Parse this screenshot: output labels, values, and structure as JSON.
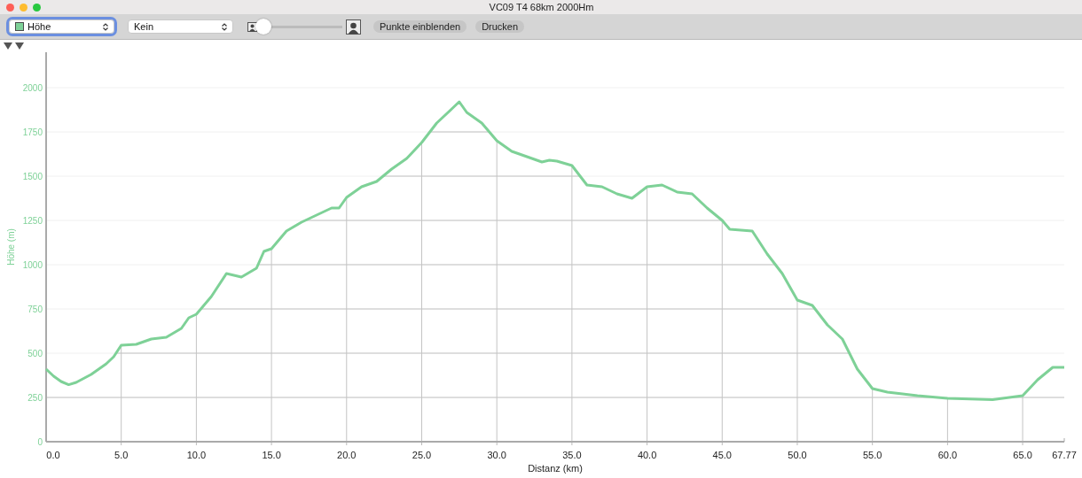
{
  "window": {
    "title": "VC09 T4 68km 2000Hm"
  },
  "toolbar": {
    "overlay_select": {
      "value": "Kein"
    },
    "zoom_slider": {
      "level": 0.0
    },
    "buttons": [
      "Punkte einblenden",
      "Drucken"
    ]
  },
  "chart": {
    "chart_data": {
      "type": "line",
      "xlabel": "Distanz (km)",
      "ylabel": "Höhe (m)",
      "x": [
        0,
        0.5,
        1,
        1.5,
        2,
        3,
        4,
        4.5,
        5,
        6,
        7,
        8,
        9,
        9.5,
        10,
        11,
        12,
        13,
        14,
        14.5,
        15,
        16,
        17,
        18,
        19,
        19.5,
        20,
        21,
        22,
        23,
        24,
        25,
        26,
        27,
        27.5,
        28,
        29,
        30,
        31,
        32,
        33,
        33.5,
        34,
        35,
        36,
        37,
        38,
        39,
        40,
        41,
        42,
        43,
        44,
        45,
        45.5,
        47,
        48,
        49,
        50,
        51,
        52,
        53,
        54,
        55,
        56,
        57,
        58,
        60,
        63,
        65,
        66,
        67,
        67.77
      ],
      "series": [
        {
          "name": "Höhe",
          "color": "#7ed197",
          "values": [
            410,
            370,
            340,
            322,
            335,
            380,
            440,
            480,
            545,
            550,
            580,
            590,
            640,
            700,
            720,
            820,
            950,
            930,
            980,
            1075,
            1090,
            1190,
            1240,
            1280,
            1320,
            1320,
            1380,
            1440,
            1470,
            1540,
            1600,
            1690,
            1800,
            1880,
            1920,
            1860,
            1800,
            1700,
            1640,
            1610,
            1580,
            1590,
            1585,
            1560,
            1450,
            1440,
            1400,
            1375,
            1440,
            1450,
            1410,
            1400,
            1320,
            1250,
            1200,
            1190,
            1060,
            950,
            800,
            770,
            660,
            580,
            410,
            300,
            280,
            270,
            260,
            245,
            238,
            260,
            350,
            420,
            420
          ]
        }
      ],
      "xlim": [
        0,
        67.77
      ],
      "ylim": [
        0,
        2200
      ],
      "grid": true,
      "xticks": [
        {
          "value": 0,
          "label": "0.0"
        },
        {
          "value": 5,
          "label": "5.0"
        },
        {
          "value": 10,
          "label": "10.0"
        },
        {
          "value": 15,
          "label": "15.0"
        },
        {
          "value": 20,
          "label": "20.0"
        },
        {
          "value": 25,
          "label": "25.0"
        },
        {
          "value": 30,
          "label": "30.0"
        },
        {
          "value": 35,
          "label": "35.0"
        },
        {
          "value": 40,
          "label": "40.0"
        },
        {
          "value": 45,
          "label": "45.0"
        },
        {
          "value": 50,
          "label": "50.0"
        },
        {
          "value": 55,
          "label": "55.0"
        },
        {
          "value": 60,
          "label": "60.0"
        },
        {
          "value": 65,
          "label": "65.0"
        },
        {
          "value": 67.77,
          "label": "67.77"
        }
      ],
      "yticks": [
        0,
        250,
        500,
        750,
        1000,
        1250,
        1500,
        1750,
        2000
      ]
    }
  }
}
